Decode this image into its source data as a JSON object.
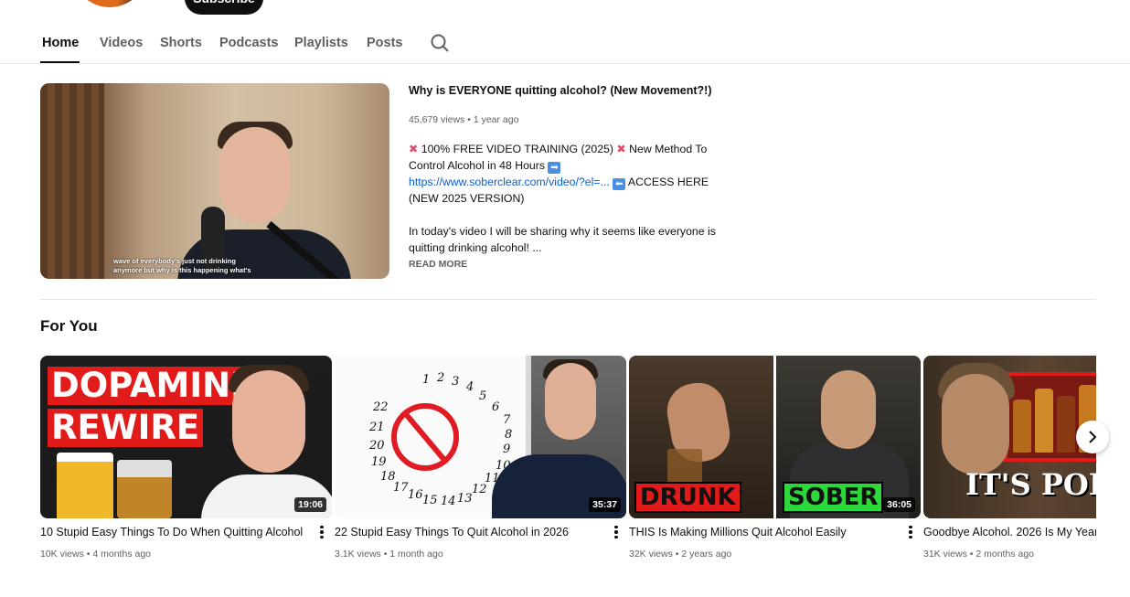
{
  "channel": {
    "subscribe_label": "Subscribe"
  },
  "tabs": [
    {
      "label": "Home",
      "active": true
    },
    {
      "label": "Videos"
    },
    {
      "label": "Shorts"
    },
    {
      "label": "Podcasts"
    },
    {
      "label": "Playlists"
    },
    {
      "label": "Posts"
    }
  ],
  "featured": {
    "title": "Why is EVERYONE quitting alcohol? (New Movement?!)",
    "views": "45,679 views",
    "age": "1 year ago",
    "caption_line1": "wave of everybody's just not drinking",
    "caption_line2": "anymore but why is this happening what's",
    "desc_part1": "100% FREE VIDEO TRAINING (2025)",
    "desc_part2": "New Method To Control Alcohol in 48 Hours",
    "desc_link": "https://www.soberclear.com/video/?el=...",
    "desc_part3": "ACCESS HERE (NEW 2025 VERSION)",
    "desc_para2": "In today's video I will be sharing why it seems like everyone is quitting drinking alcohol! ...",
    "read_more": "READ MORE"
  },
  "section": {
    "title": "For You"
  },
  "videos": [
    {
      "title": "10 Stupid Easy Things To Do When Quitting Alcohol",
      "views": "10K views",
      "age": "4 months ago",
      "duration": "19:06",
      "thumb_text1": "DOPAMINE",
      "thumb_text2": "REWIRE"
    },
    {
      "title": "22 Stupid Easy Things To Quit Alcohol in 2026",
      "views": "3.1K views",
      "age": "1 month ago",
      "duration": "35:37"
    },
    {
      "title": "THIS Is Making Millions Quit Alcohol Easily",
      "views": "32K views",
      "age": "2 years ago",
      "duration": "36:05",
      "thumb_text1": "DRUNK",
      "thumb_text2": "SOBER"
    },
    {
      "title": "Goodbye Alcohol. 2026 Is My Year",
      "views": "31K views",
      "age": "2 months ago",
      "thumb_text1": "IT'S POI"
    }
  ],
  "colors": {
    "accent_red": "#e11a1a",
    "link_blue": "#065fd4",
    "meta_gray": "#606060"
  },
  "icons": {
    "search": "search-icon",
    "next": "chevron-right-icon",
    "more": "more-vert-icon"
  }
}
